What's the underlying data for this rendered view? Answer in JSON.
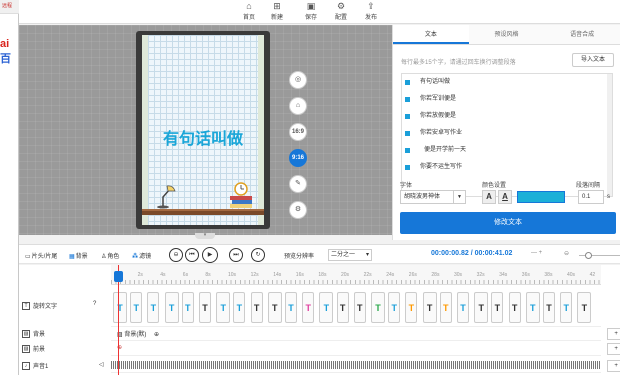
{
  "bg_window": {
    "tab": "远程",
    "logo_a": "ai",
    "logo_b": "百"
  },
  "toolbar": {
    "items": [
      {
        "label": "首页",
        "icon": "home-icon"
      },
      {
        "label": "新建",
        "icon": "new-file-icon"
      },
      {
        "label": "保存",
        "icon": "save-icon"
      },
      {
        "label": "配置",
        "icon": "gear-icon"
      },
      {
        "label": "发布",
        "icon": "publish-icon"
      }
    ]
  },
  "canvas": {
    "title_text": "有句话叫做",
    "side_tools": [
      "reset-icon",
      "lock-icon",
      "16:9",
      "9:16",
      "edit-icon",
      "settings-icon"
    ],
    "active_ratio": "9:16"
  },
  "right_panel": {
    "tabs": [
      "文本",
      "预设风格",
      "语音合成"
    ],
    "active_tab": "文本",
    "hint": "每行最多15个字，请通过回车换行调整段落",
    "import_label": "导入文本",
    "lines": [
      "有句话叫做",
      "你若军训便是",
      "你若放假便是",
      "你若安卓写作业",
      "便是开学前一天",
      "你要不运生写作"
    ],
    "font_label": "字体",
    "font_value": "胡晓波男神体",
    "color_label": "颜色设置",
    "spacing_label": "段落间隔",
    "spacing_value": "0.1",
    "spacing_unit": "s",
    "swatch_color": "#1cb0d8",
    "modify_label": "修改文本"
  },
  "controls": {
    "head_tail": "片头/片尾",
    "bg": "背景",
    "role": "角色",
    "effect": "滤镜",
    "preview_label": "预览分辨率",
    "preview_value": "二分之一",
    "time_current": "00:00:00.82",
    "time_sep": " / ",
    "time_total": "00:00:41.02"
  },
  "timeline": {
    "ticks": [
      "0s",
      "2s",
      "4s",
      "6s",
      "8s",
      "10s",
      "12s",
      "14s",
      "16s",
      "18s",
      "20s",
      "22s",
      "24s",
      "26s",
      "28s",
      "30s",
      "32s",
      "34s",
      "36s",
      "38s",
      "40s",
      "42"
    ],
    "tracks": [
      {
        "name": "旋转文字",
        "type": "text"
      },
      {
        "name": "背景",
        "type": "bg",
        "chip": "背景(默)"
      },
      {
        "name": "前景",
        "type": "fg"
      },
      {
        "name": "声音1",
        "type": "audio"
      }
    ],
    "add_bg": "+ 背景",
    "add_fg": "+ 前景",
    "add_audio": "+ 音轨",
    "clip_colors": [
      "#1a9fd9",
      "#1a9fd9",
      "#1a9fd9",
      "#1a9fd9",
      "#1a9fd9",
      "#333",
      "#1a9fd9",
      "#1a9fd9",
      "#333",
      "#333",
      "#1a9fd9",
      "#e040a0",
      "#1a9fd9",
      "#333",
      "#333",
      "#2aa84a",
      "#1a9fd9",
      "#ff9900",
      "#333",
      "#ff9900",
      "#1a9fd9",
      "#333",
      "#333",
      "#333",
      "#1a9fd9",
      "#333",
      "#1a9fd9",
      "#333"
    ]
  }
}
